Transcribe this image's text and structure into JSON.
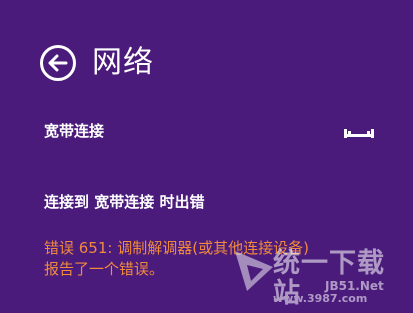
{
  "header": {
    "title": "网络",
    "back_icon": "back-arrow-icon"
  },
  "network": {
    "name": "宽带连接",
    "icon": "wired-ethernet-icon"
  },
  "status": {
    "message": "连接到 宽带连接 时出错"
  },
  "error": {
    "line1": "错误 651: 调制解调器(或其他连接设备)",
    "line2": "报告了一个错误。"
  },
  "watermark": {
    "name": "统一下载站",
    "domain": "JB51.Net",
    "url": "www.3987.com",
    "logo_icon": "triangle-logo-icon"
  },
  "colors": {
    "background": "#4b1b7c",
    "text": "#ffffff",
    "error": "#f08a3c"
  }
}
